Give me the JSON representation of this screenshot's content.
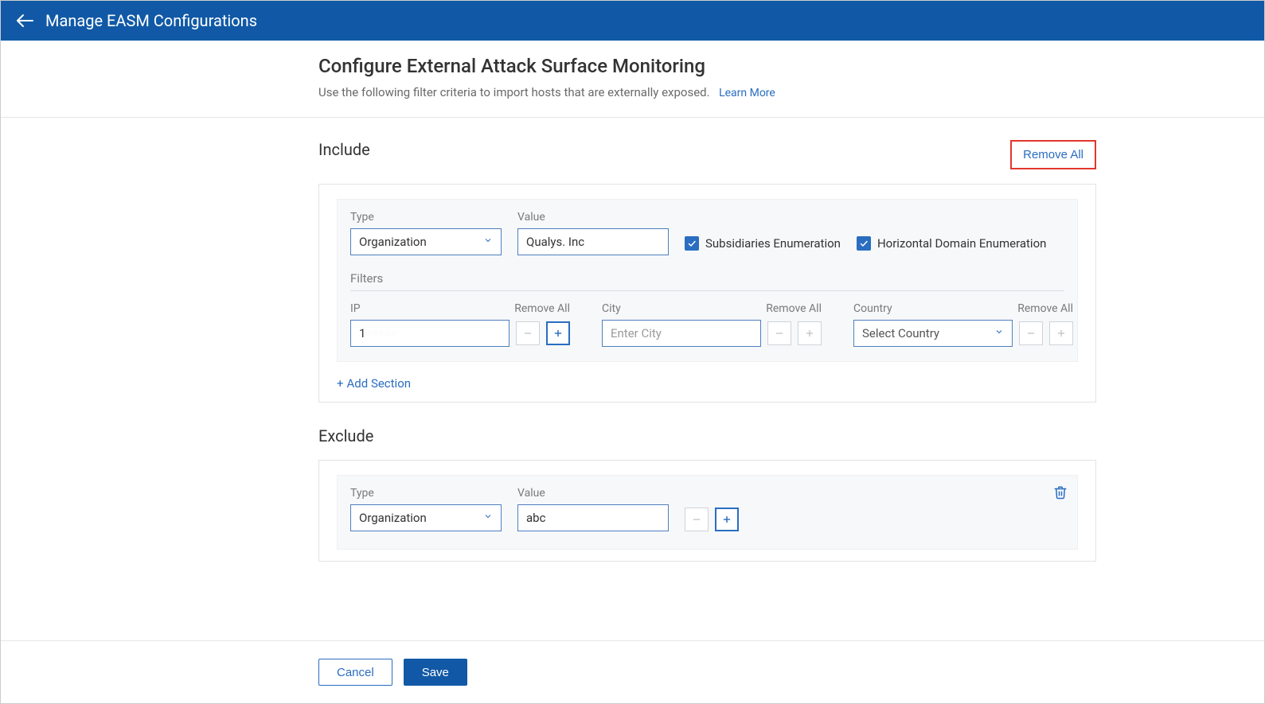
{
  "header": {
    "title": "Manage EASM Configurations"
  },
  "page": {
    "heading": "Configure External Attack Surface Monitoring",
    "subtitle": "Use the following filter criteria to import hosts that are externally exposed.",
    "learn_more": "Learn More"
  },
  "include": {
    "title": "Include",
    "remove_all": "Remove All",
    "type_label": "Type",
    "type_value": "Organization",
    "value_label": "Value",
    "value_text": "Qualys. Inc",
    "subsidiaries_label": "Subsidiaries Enumeration",
    "horizontal_label": "Horizontal Domain Enumeration",
    "filters_label": "Filters",
    "ip": {
      "label": "IP",
      "remove_all": "Remove All",
      "value": "1"
    },
    "city": {
      "label": "City",
      "remove_all": "Remove All",
      "placeholder": "Enter City"
    },
    "country": {
      "label": "Country",
      "remove_all": "Remove All",
      "placeholder": "Select Country"
    },
    "add_section": "Add Section"
  },
  "exclude": {
    "title": "Exclude",
    "type_label": "Type",
    "type_value": "Organization",
    "value_label": "Value",
    "value_text": "abc"
  },
  "footer": {
    "cancel": "Cancel",
    "save": "Save"
  }
}
